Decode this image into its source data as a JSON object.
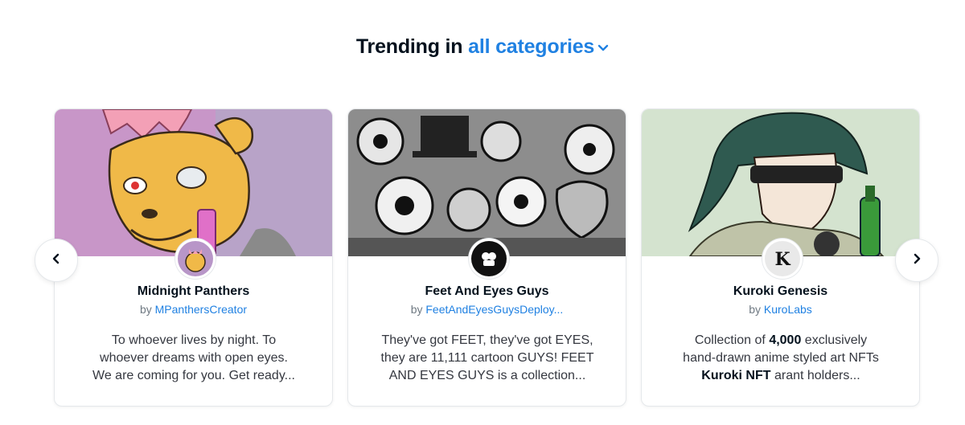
{
  "heading": {
    "prefix": "Trending in",
    "category": "all categories",
    "chevron_icon": "chevron-down-icon",
    "accent_color": "#2081e2"
  },
  "carousel": {
    "prev_icon": "chevron-left-icon",
    "next_icon": "chevron-right-icon"
  },
  "cards": [
    {
      "title": "Midnight Panthers",
      "by_prefix": "by",
      "creator": "MPanthersCreator",
      "description": [
        "To whoever lives by night. To",
        "whoever dreams with open eyes.",
        "We are coming for you. Get ready..."
      ],
      "banner_bg": "#c18fc4"
    },
    {
      "title": "Feet And Eyes Guys",
      "by_prefix": "by",
      "creator": "FeetAndEyesGuysDeploy...",
      "description": [
        "They've got FEET, they've got EYES,",
        "they are 11,111 cartoon GUYS! FEET",
        "AND EYES GUYS is a collection..."
      ],
      "banner_bg": "#9a9a9a"
    },
    {
      "title": "Kuroki Genesis",
      "by_prefix": "by",
      "creator": "KuroLabs",
      "description": {
        "line1_pre": "Collection of ",
        "line1_bold": "4,000",
        "line1_post": " exclusively",
        "line2": "hand-drawn anime styled art NFTs",
        "line3_bold": "Kuroki NFT",
        "line3_post": " arant holders..."
      },
      "avatar_letter": "K",
      "banner_bg": "#d4e4cf"
    }
  ]
}
